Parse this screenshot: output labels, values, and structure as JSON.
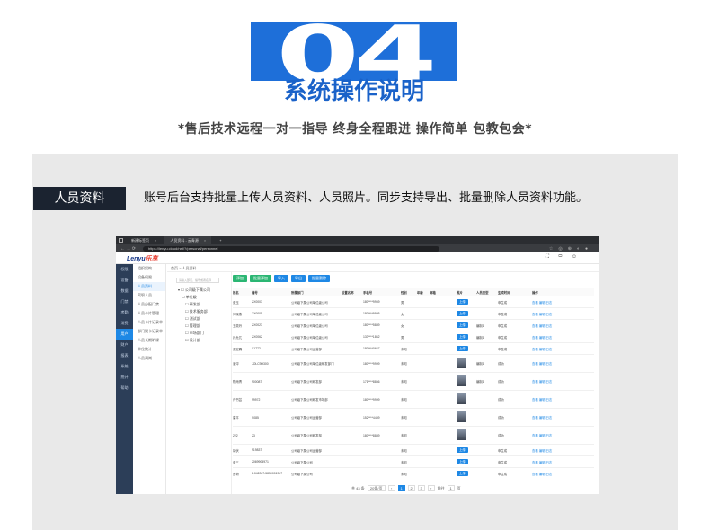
{
  "header": {
    "logo_big": "04",
    "logo_title": "系统操作说明",
    "subtitle": "*售后技术远程一对一指导 终身全程跟进 操作简单 包教包会*"
  },
  "section": {
    "tag": "人员资料",
    "description": "账号后台支持批量上传人员资料、人员照片。同步支持导出、批量删除人员资料功能。"
  },
  "screenshot": {
    "tabs": [
      "新建标签页",
      "人员资料 - 云青源"
    ],
    "url": "https://lenyu.cloud/net/?/personal/personnel",
    "brand_main": "Lenyu",
    "brand_accent": "乐享",
    "header_icons": [
      "expand-icon",
      "message-icon",
      "user-icon"
    ],
    "sidebar": [
      "权限",
      "设备",
      "数据",
      "门禁",
      "考勤",
      "消费",
      "用户",
      "财户",
      "报表",
      "系统",
      "统计",
      "帮助"
    ],
    "sidebar_active_index": 6,
    "subnav": [
      "组织架构",
      "设备权限",
      "人员资料",
      "离职人员",
      "人员分配门禁",
      "人员卡片管理",
      "人员卡片记录单",
      "部门脱卡记录单",
      "人员长期旷课",
      "单位统计",
      "人员调岗"
    ],
    "subnav_active_index": 2,
    "crumb": "首页  > 人员资料",
    "tree_search": "请输入部门、编号或者名称",
    "tree": [
      "公司级下属公司",
      "单位级",
      "研发部",
      "技术服务部",
      "测试部",
      "管理部",
      "市场部门",
      "设计部"
    ],
    "toolbar": [
      "添加",
      "批量添加",
      "导入",
      "导出",
      "批量删除"
    ],
    "columns": [
      "姓名",
      "编号",
      "所属部门",
      "设置名称",
      "手机号",
      "性别",
      "年龄",
      "邮箱",
      "照片",
      "人员类型",
      "生成时间",
      "",
      "操作"
    ],
    "rows": [
      [
        "张玉",
        "ZX0003",
        "公司级下属公司单位级公司",
        "",
        "180****9969",
        "男",
        "",
        "",
        "上传",
        "",
        "申生成",
        "",
        "查看 编辑 日志"
      ],
      [
        "何晓燕",
        "ZX0005",
        "公司级下属公司单位级公司",
        "",
        "180****9995",
        "女",
        "",
        "",
        "上传",
        "",
        "申生成",
        "",
        "查看 编辑 日志"
      ],
      [
        "王奕玲",
        "ZX0023",
        "公司级下属公司单位级公司",
        "",
        "180****5889",
        "女",
        "",
        "",
        "上传",
        "编制1",
        "申生成",
        "",
        "查看 编辑 日志"
      ],
      [
        "孙允兀",
        "ZX0062",
        "公司级下属公司单位级公司",
        "",
        "133****1862",
        "男",
        "",
        "",
        "上传",
        "编制1",
        "申生成",
        "",
        "查看 编辑 日志"
      ],
      [
        "张宏霖",
        "Y1772",
        "公司级下属公司运营部",
        "",
        "180****0667",
        "未知",
        "",
        "",
        "上传",
        "",
        "申生成",
        "",
        "查看 编辑 日志"
      ],
      [
        "潘泙",
        "JOLC9H300",
        "公司级下属公司单位级研发部门",
        "",
        "180****9999",
        "未知",
        "",
        "",
        "",
        "编制1",
        "成功",
        "",
        "查看 编辑 日志"
      ],
      [
        "陈雨青",
        "900087",
        "公司级下属公司研发部",
        "",
        "171****8856",
        "未知",
        "",
        "",
        "",
        "编制1",
        "成功",
        "",
        "查看 编辑 日志"
      ],
      [
        "许书芸",
        "99972",
        "公司级下属公司研发市场部",
        "",
        "180****9999",
        "未知",
        "",
        "",
        "",
        "",
        "成功",
        "",
        "查看 编辑 日志"
      ],
      [
        "康平",
        "S085",
        "公司级下属公司运营部",
        "",
        "152****4459",
        "未知",
        "",
        "",
        "",
        "",
        "成功",
        "",
        "查看 编辑 日志"
      ],
      [
        "222",
        "23",
        "公司级下属公司研发部",
        "",
        "180****8889",
        "未知",
        "",
        "",
        "",
        "",
        "成功",
        "",
        "查看 编辑 日志"
      ],
      [
        "胡伏",
        "919837",
        "公司级下属公司运营部",
        "",
        "",
        "未知",
        "",
        "",
        "上传",
        "",
        "申生成",
        "",
        "查看 编辑 日志"
      ],
      [
        "张三",
        "2069904971",
        "公司级下属公司",
        "",
        "",
        "未知",
        "",
        "",
        "上传",
        "",
        "申生成",
        "",
        "查看 编辑 日志"
      ],
      [
        "宫荷",
        "8.042067-5850001967",
        "公司级下属公司",
        "",
        "",
        "未知",
        "",
        "",
        "上传",
        "",
        "申生成",
        "",
        "查看 编辑 日志"
      ]
    ],
    "pager": {
      "total": "共 43 条",
      "size": "20条/页",
      "pages": [
        "1",
        "2",
        "3"
      ],
      "active": "1",
      "goto": "前往",
      "page_input": "1",
      "unit": "页"
    }
  }
}
